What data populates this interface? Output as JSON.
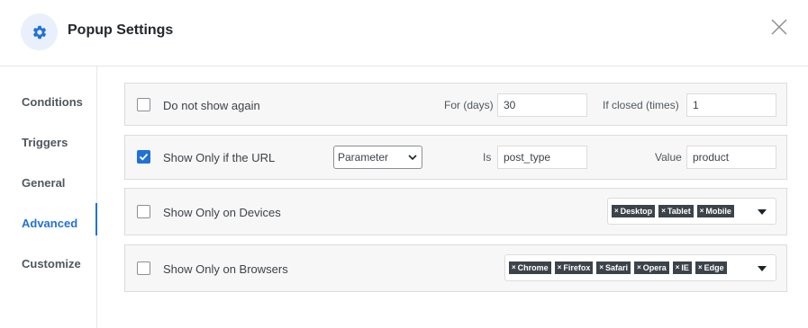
{
  "header": {
    "title": "Popup Settings",
    "icon": "gear-icon",
    "close_icon": "close-icon"
  },
  "sidebar": {
    "active": "Advanced",
    "items": [
      {
        "label": "Conditions"
      },
      {
        "label": "Triggers"
      },
      {
        "label": "General"
      },
      {
        "label": "Advanced"
      },
      {
        "label": "Customize"
      }
    ]
  },
  "rows": {
    "do_not_show": {
      "label": "Do not show again",
      "checked": false,
      "days_label": "For (days)",
      "days_value": "30",
      "closed_label": "If closed (times)",
      "closed_value": "1"
    },
    "url": {
      "label": "Show Only if the URL",
      "checked": true,
      "select_value": "Parameter",
      "is_label": "Is",
      "is_value": "post_type",
      "value_label": "Value",
      "value_value": "product"
    },
    "devices": {
      "label": "Show Only on Devices",
      "checked": false,
      "tags": [
        "Desktop",
        "Tablet",
        "Mobile"
      ]
    },
    "browsers": {
      "label": "Show Only on Browsers",
      "checked": false,
      "tags": [
        "Chrome",
        "Firefox",
        "Safari",
        "Opera",
        "IE",
        "Edge"
      ]
    }
  },
  "colors": {
    "accent": "#2271d8",
    "tag_bg": "#3c434a",
    "row_bg": "#f7f7f7"
  }
}
